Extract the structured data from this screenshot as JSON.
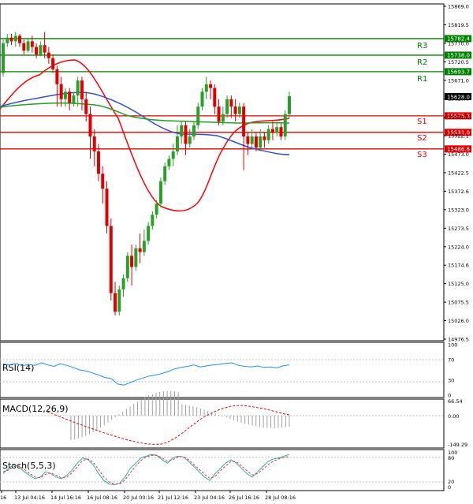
{
  "chart_data": [
    {
      "type": "candlestick",
      "panel": "price",
      "ylim": [
        14950,
        15880
      ],
      "y_ticks": [
        "15869.0",
        "15819.5",
        "15770.0",
        "15720.5",
        "15671.0",
        "15620.6",
        "15571.6",
        "15522.1",
        "15473.0",
        "15422.5",
        "15372.6",
        "15323.0",
        "15273.5",
        "15224.0",
        "15174.6",
        "15125.0",
        "15075.5",
        "15026.0",
        "14976.5"
      ],
      "x_labels": [
        "16",
        "13 Jul 04:16",
        "14 Jul 16:16",
        "16 Jul 08:16",
        "20 Jul 00:16",
        "21 Jul 12:16",
        "23 Jul 04:16",
        "26 Jul 16:16",
        "28 Jul 08:16"
      ],
      "current_price": "15628.0",
      "levels": [
        {
          "name": "R3",
          "value": 15782.4,
          "label": "15782.4",
          "color": "#008000"
        },
        {
          "name": "R2",
          "value": 15738.0,
          "label": "15738.0",
          "color": "#008000"
        },
        {
          "name": "R1",
          "value": 15693.7,
          "label": "15693.7",
          "color": "#008000"
        },
        {
          "name": "S1",
          "value": 15575.3,
          "label": "15575.3",
          "color": "#e00000"
        },
        {
          "name": "S2",
          "value": 15531.0,
          "label": "15531.0",
          "color": "#e00000"
        },
        {
          "name": "S3",
          "value": 15486.6,
          "label": "15486.6",
          "color": "#e00000"
        }
      ],
      "candles": [
        [
          15690,
          15770,
          15680,
          15780
        ],
        [
          15770,
          15785,
          15760,
          15795
        ],
        [
          15785,
          15775,
          15765,
          15795
        ],
        [
          15775,
          15790,
          15760,
          15800
        ],
        [
          15790,
          15770,
          15760,
          15795
        ],
        [
          15770,
          15750,
          15740,
          15780
        ],
        [
          15750,
          15775,
          15745,
          15785
        ],
        [
          15775,
          15760,
          15745,
          15790
        ],
        [
          15760,
          15740,
          15730,
          15770
        ],
        [
          15740,
          15765,
          15735,
          15775
        ],
        [
          15765,
          15745,
          15730,
          15800
        ],
        [
          15745,
          15730,
          15715,
          15760
        ],
        [
          15730,
          15700,
          15690,
          15740
        ],
        [
          15700,
          15660,
          15600,
          15710
        ],
        [
          15660,
          15620,
          15600,
          15680
        ],
        [
          15620,
          15640,
          15600,
          15650
        ],
        [
          15640,
          15610,
          15590,
          15650
        ],
        [
          15610,
          15630,
          15600,
          15640
        ],
        [
          15630,
          15670,
          15600,
          15680
        ],
        [
          15670,
          15620,
          15590,
          15680
        ],
        [
          15620,
          15580,
          15560,
          15640
        ],
        [
          15580,
          15520,
          15460,
          15600
        ],
        [
          15520,
          15480,
          15440,
          15540
        ],
        [
          15480,
          15420,
          15400,
          15500
        ],
        [
          15420,
          15380,
          15340,
          15440
        ],
        [
          15380,
          15280,
          15260,
          15400
        ],
        [
          15280,
          15100,
          15080,
          15300
        ],
        [
          15100,
          15050,
          15040,
          15130
        ],
        [
          15050,
          15110,
          15040,
          15120
        ],
        [
          15110,
          15140,
          15090,
          15150
        ],
        [
          15140,
          15200,
          15130,
          15210
        ],
        [
          15200,
          15170,
          15120,
          15230
        ],
        [
          15170,
          15220,
          15160,
          15230
        ],
        [
          15220,
          15210,
          15180,
          15260
        ],
        [
          15210,
          15240,
          15200,
          15270
        ],
        [
          15240,
          15280,
          15230,
          15290
        ],
        [
          15280,
          15310,
          15270,
          15320
        ],
        [
          15310,
          15340,
          15300,
          15350
        ],
        [
          15340,
          15400,
          15330,
          15410
        ],
        [
          15400,
          15440,
          15390,
          15450
        ],
        [
          15440,
          15460,
          15430,
          15470
        ],
        [
          15460,
          15480,
          15440,
          15500
        ],
        [
          15480,
          15520,
          15470,
          15550
        ],
        [
          15520,
          15550,
          15500,
          15560
        ],
        [
          15550,
          15500,
          15470,
          15560
        ],
        [
          15500,
          15520,
          15490,
          15540
        ],
        [
          15520,
          15550,
          15510,
          15560
        ],
        [
          15550,
          15600,
          15540,
          15610
        ],
        [
          15600,
          15640,
          15590,
          15650
        ],
        [
          15640,
          15660,
          15620,
          15680
        ],
        [
          15660,
          15650,
          15620,
          15670
        ],
        [
          15650,
          15600,
          15580,
          15660
        ],
        [
          15600,
          15560,
          15550,
          15620
        ],
        [
          15560,
          15580,
          15550,
          15600
        ],
        [
          15580,
          15620,
          15570,
          15630
        ],
        [
          15620,
          15600,
          15570,
          15630
        ],
        [
          15600,
          15580,
          15560,
          15620
        ],
        [
          15580,
          15600,
          15570,
          15610
        ],
        [
          15600,
          15520,
          15430,
          15610
        ],
        [
          15520,
          15500,
          15470,
          15530
        ],
        [
          15500,
          15520,
          15490,
          15540
        ],
        [
          15520,
          15490,
          15480,
          15530
        ],
        [
          15490,
          15520,
          15480,
          15540
        ],
        [
          15520,
          15510,
          15490,
          15530
        ],
        [
          15510,
          15540,
          15500,
          15550
        ],
        [
          15540,
          15530,
          15510,
          15560
        ],
        [
          15530,
          15545,
          15520,
          15560
        ],
        [
          15545,
          15520,
          15510,
          15555
        ],
        [
          15520,
          15580,
          15510,
          15590
        ],
        [
          15580,
          15628,
          15570,
          15640
        ]
      ],
      "ma_series": [
        {
          "color": "#ff0000"
        },
        {
          "color": "#3050d8"
        },
        {
          "color": "#22a022"
        }
      ]
    },
    {
      "type": "line",
      "panel": "rsi",
      "title": "RSI(14)",
      "ylim": [
        0,
        100
      ],
      "y_ticks": [
        "100",
        "70",
        "30",
        "0"
      ],
      "series": [
        {
          "color": "#1e90ff",
          "values": [
            62,
            60,
            63,
            58,
            61,
            59,
            64,
            60,
            57,
            62,
            59,
            55,
            50,
            48,
            44,
            40,
            35,
            33,
            22,
            20,
            25,
            30,
            34,
            38,
            40,
            43,
            47,
            52,
            55,
            57,
            60,
            56,
            58,
            60,
            61,
            63,
            64,
            59,
            57,
            56,
            58,
            55,
            56,
            54,
            58,
            60
          ]
        }
      ]
    },
    {
      "type": "line",
      "panel": "macd",
      "title": "MACD(12,26,9)",
      "ylim": [
        -160,
        80
      ],
      "y_ticks": [
        "66.54",
        "0.00",
        "-149.29"
      ]
    },
    {
      "type": "line",
      "panel": "stoch",
      "title": "Stoch(5,5,3)",
      "ylim": [
        0,
        100
      ],
      "y_ticks": [
        "100",
        "80",
        "20",
        "0"
      ],
      "series": [
        {
          "color": "#20b2aa",
          "values": [
            40,
            55,
            65,
            60,
            45,
            35,
            25,
            30,
            45,
            40,
            30,
            25,
            35,
            50,
            70,
            85,
            80,
            65,
            40,
            20,
            10,
            8,
            12,
            30,
            55,
            70,
            85,
            90,
            95,
            92,
            80,
            70,
            85,
            90,
            88,
            75,
            60,
            45,
            30,
            20,
            40,
            55,
            70,
            80,
            70,
            55,
            40,
            30,
            45,
            60,
            75,
            82,
            85,
            90,
            95
          ]
        },
        {
          "color": "#ff3030",
          "values": [
            45,
            50,
            60,
            62,
            52,
            40,
            30,
            28,
            38,
            42,
            35,
            28,
            30,
            42,
            60,
            78,
            82,
            72,
            52,
            30,
            16,
            10,
            10,
            22,
            42,
            62,
            78,
            88,
            92,
            93,
            85,
            75,
            80,
            88,
            89,
            80,
            66,
            52,
            38,
            26,
            32,
            48,
            62,
            75,
            74,
            62,
            48,
            36,
            40,
            52,
            66,
            76,
            82,
            86,
            90
          ]
        }
      ]
    }
  ]
}
